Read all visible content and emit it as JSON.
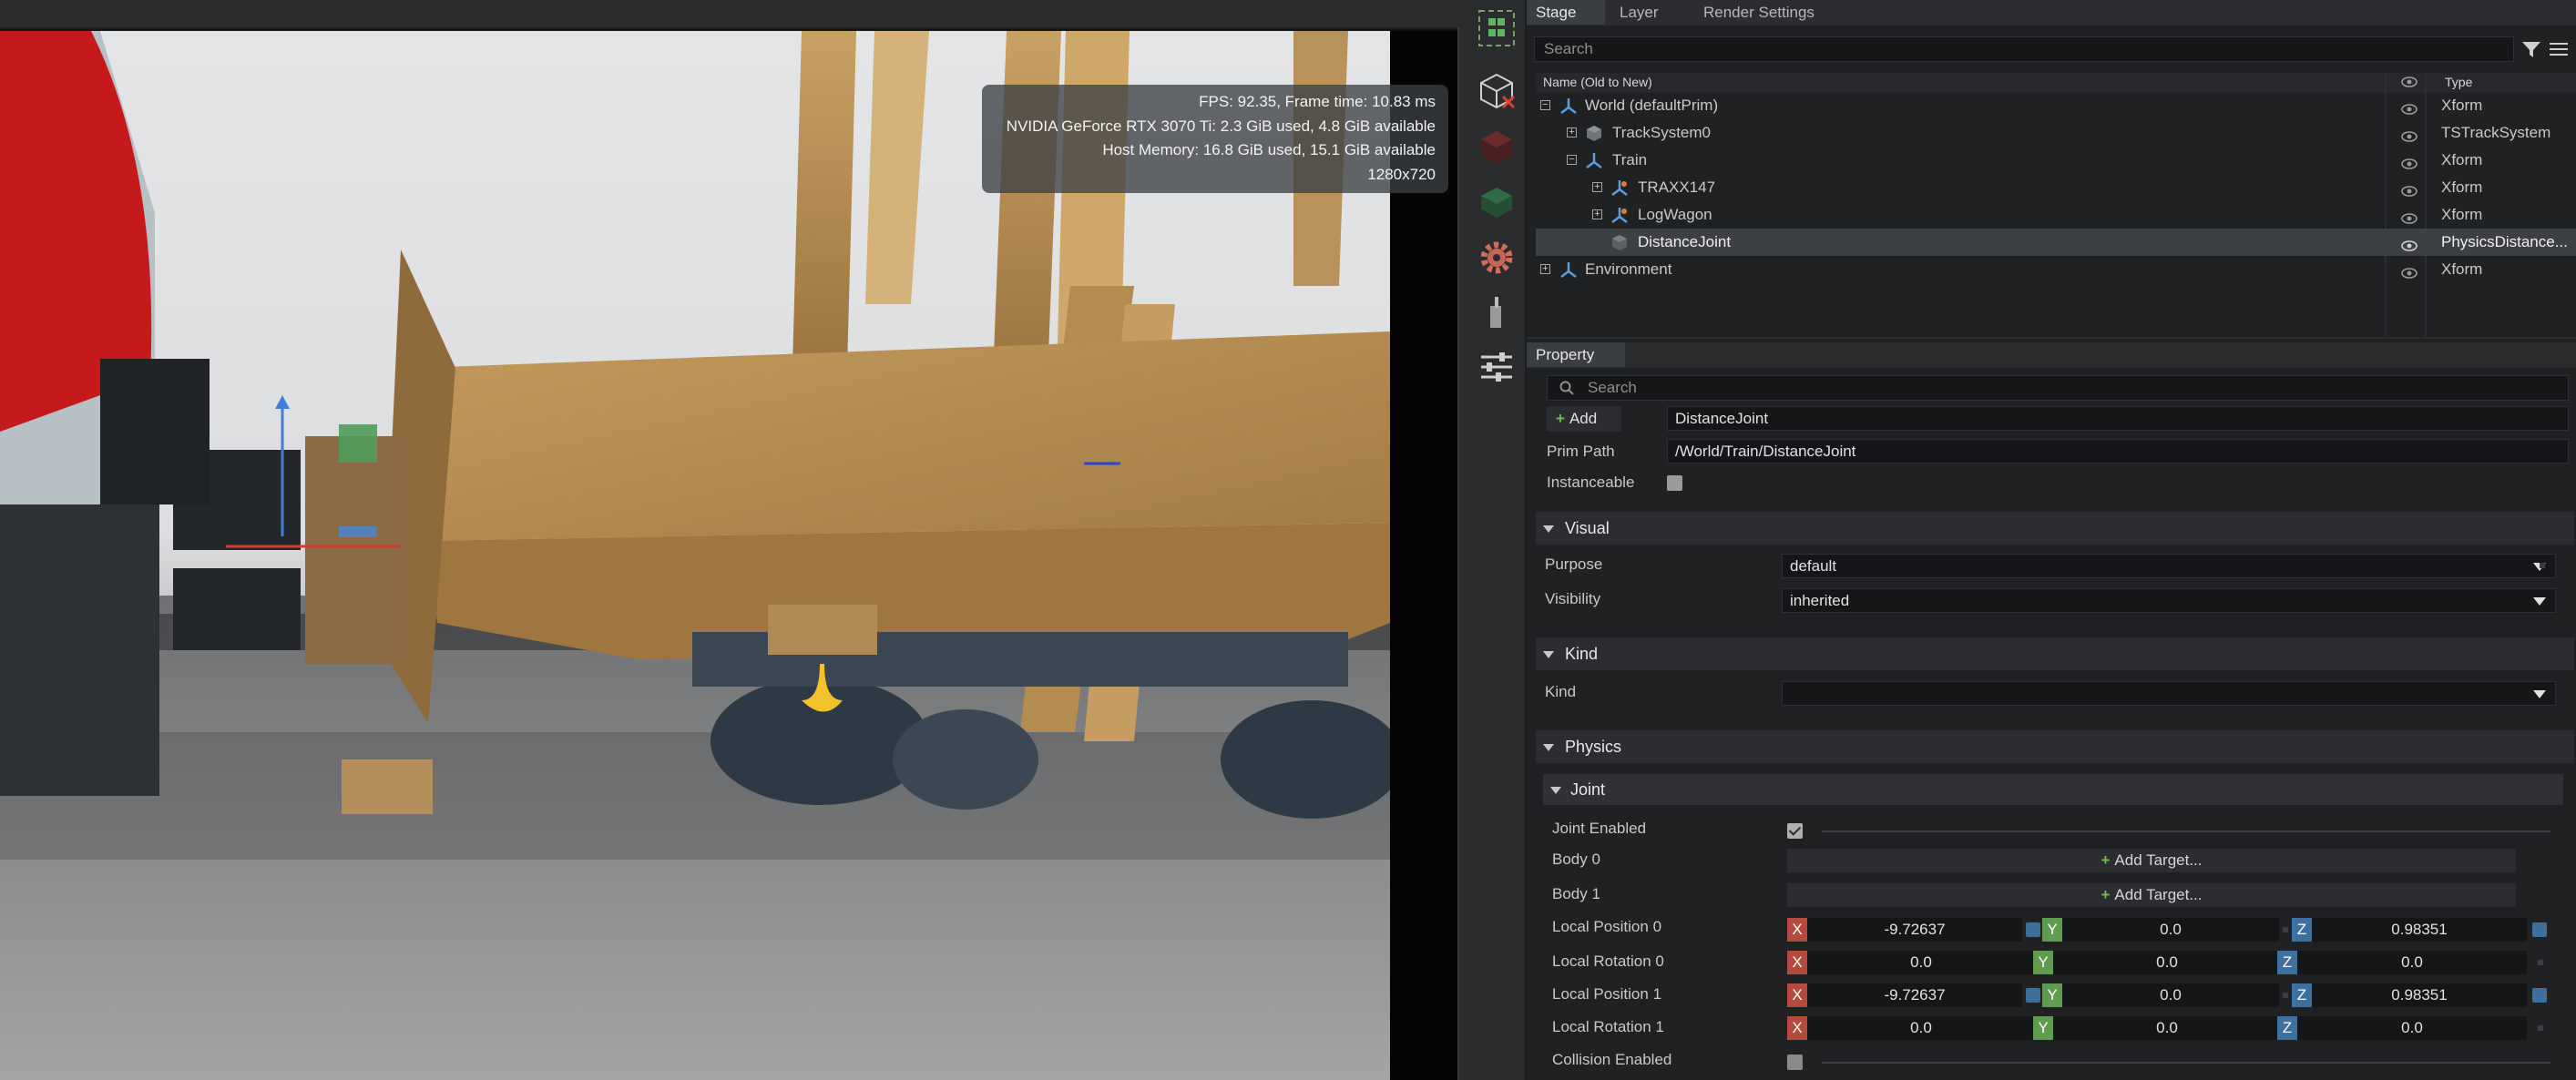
{
  "viewport": {
    "stats": {
      "fps": "FPS: 92.35, Frame time: 10.83 ms",
      "gpu": "NVIDIA GeForce RTX 3070 Ti: 2.3 GiB used, 4.8 GiB available",
      "host_memory": "Host Memory: 16.8 GiB used, 15.1 GiB available",
      "resolution": "1280x720"
    }
  },
  "toolbar": {
    "tools": [
      "select-mode-icon",
      "clear-selection-icon",
      "cube-icon",
      "physics-layer-icon",
      "settings-gear-icon",
      "pedestal-icon",
      "sliders-icon"
    ]
  },
  "stage": {
    "tabs": [
      "Stage",
      "Layer",
      "Render Settings"
    ],
    "search_placeholder": "Search",
    "columns": {
      "name": "Name (Old to New)",
      "type": "Type"
    },
    "rows": [
      {
        "name": "World (defaultPrim)",
        "type": "Xform"
      },
      {
        "name": "TrackSystem0",
        "type": "TSTrackSystem"
      },
      {
        "name": "Train",
        "type": "Xform"
      },
      {
        "name": "TRAXX147",
        "type": "Xform"
      },
      {
        "name": "LogWagon",
        "type": "Xform"
      },
      {
        "name": "DistanceJoint",
        "type": "PhysicsDistance..."
      },
      {
        "name": "Environment",
        "type": "Xform"
      }
    ]
  },
  "property": {
    "tab": "Property",
    "search_placeholder": "Search",
    "add_label": "Add",
    "prim_name": "DistanceJoint",
    "prim_path_label": "Prim Path",
    "prim_path": "/World/Train/DistanceJoint",
    "instanceable_label": "Instanceable",
    "visual": {
      "title": "Visual",
      "purpose_label": "Purpose",
      "purpose": "default",
      "visibility_label": "Visibility",
      "visibility": "inherited"
    },
    "kind": {
      "title": "Kind",
      "kind_label": "Kind",
      "kind": ""
    },
    "physics": {
      "title": "Physics",
      "joint": {
        "title": "Joint",
        "joint_enabled_label": "Joint Enabled",
        "joint_enabled": true,
        "body0_label": "Body 0",
        "body1_label": "Body 1",
        "add_target": "Add Target...",
        "local_position_0_label": "Local Position 0",
        "local_position_0": [
          "-9.72637",
          "0.0",
          "0.98351"
        ],
        "local_rotation_0_label": "Local Rotation 0",
        "local_rotation_0": [
          "0.0",
          "0.0",
          "0.0"
        ],
        "local_position_1_label": "Local Position 1",
        "local_position_1": [
          "-9.72637",
          "0.0",
          "0.98351"
        ],
        "local_rotation_1_label": "Local Rotation 1",
        "local_rotation_1": [
          "0.0",
          "0.0",
          "0.0"
        ],
        "collision_enabled_label": "Collision Enabled",
        "collision_enabled": false
      }
    },
    "axis_labels": [
      "X",
      "Y",
      "Z"
    ]
  }
}
